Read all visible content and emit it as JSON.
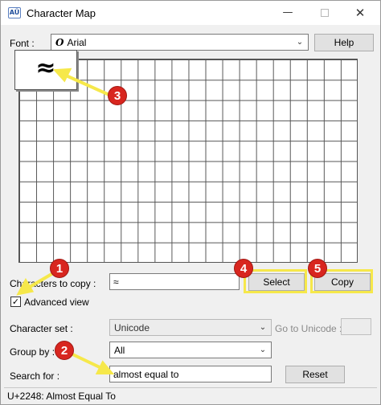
{
  "window": {
    "title": "Character Map",
    "app_icon_text": "AÜ",
    "minimize_glyph": "—",
    "close_glyph": "✕"
  },
  "font": {
    "label": "Font :",
    "glyph": "O",
    "value": "Arial",
    "help_button": "Help"
  },
  "grid": {
    "columns": 20,
    "rows": 10,
    "zoomed_char": "≈"
  },
  "copy_row": {
    "label": "Characters to copy :",
    "value": "≈",
    "select_button": "Select",
    "copy_button": "Copy"
  },
  "advanced": {
    "label": "Advanced view",
    "checked": true
  },
  "character_set": {
    "label": "Character set :",
    "value": "Unicode",
    "goto_label": "Go to Unicode :",
    "goto_value": ""
  },
  "group_by": {
    "label": "Group by :",
    "value": "All"
  },
  "search": {
    "label": "Search for :",
    "value": "almost equal to",
    "reset_button": "Reset"
  },
  "status_bar": {
    "text": "U+2248: Almost Equal To"
  },
  "annotations": {
    "badges": [
      "1",
      "2",
      "3",
      "4",
      "5"
    ],
    "highlight_color": "#f6e84a",
    "badge_color": "#d8261f"
  }
}
